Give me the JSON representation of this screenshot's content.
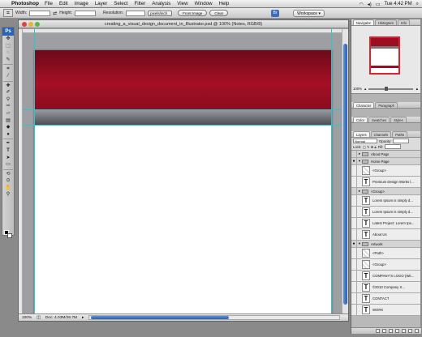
{
  "menubar": {
    "apple": "",
    "app_name": "Photoshop",
    "items": [
      "File",
      "Edit",
      "Image",
      "Layer",
      "Select",
      "Filter",
      "Analysis",
      "View",
      "Window",
      "Help"
    ],
    "clock": "Tue 4:42 PM"
  },
  "options": {
    "width_label": "Width:",
    "height_label": "Height:",
    "resolution_label": "Resolution:",
    "units_value": "pixels/inch",
    "front_image_label": "Front Image",
    "clear_label": "Clear",
    "workspace_label": "Workspace ▾"
  },
  "tools": {
    "logo": "Ps",
    "items": [
      "move",
      "marquee",
      "lasso",
      "quick-select",
      "crop",
      "eyedropper",
      "spot-heal",
      "brush",
      "clone-stamp",
      "history-brush",
      "eraser",
      "gradient",
      "blur",
      "dodge",
      "pen",
      "type",
      "path-select",
      "shape",
      "3d-rotate",
      "3d-orbit",
      "hand",
      "zoom"
    ]
  },
  "document": {
    "title": "creating_a_visual_design_document_in_Illustrator.psd @ 100% (Notes, RGB/8)",
    "zoom": "100%",
    "doc_info": "Doc: 4.03M/26.7M",
    "colors": {
      "banner": "#a50f25",
      "guide": "#28c7d4"
    }
  },
  "navigator": {
    "tabs": [
      "Navigator",
      "Histogram",
      "Info"
    ],
    "zoom": "100%"
  },
  "panel_groups": {
    "group1": [
      "Character",
      "Paragraph"
    ],
    "group2": [
      "Color",
      "Swatches",
      "Styles"
    ]
  },
  "layers": {
    "tabs": [
      "Layers",
      "Channels",
      "Paths"
    ],
    "blend_mode": "Normal",
    "opacity_label": "Opacity:",
    "lock_label": "Lock:",
    "fill_label": "Fill:",
    "items": [
      {
        "name": "About Page",
        "type": "folder",
        "visible": false,
        "expanded": false
      },
      {
        "name": "Home Page",
        "type": "folder",
        "visible": true,
        "expanded": true
      },
      {
        "name": "<Group>",
        "type": "image",
        "visible": false,
        "expanded": false
      },
      {
        "name": "Premium Design Works l...",
        "type": "text",
        "visible": false,
        "expanded": false
      },
      {
        "name": "<Group>",
        "type": "folder",
        "visible": false,
        "expanded": false
      },
      {
        "name": "Lorem Ipsum is simply d...",
        "type": "text",
        "visible": false,
        "expanded": false
      },
      {
        "name": "Lorem Ipsum is simply d...",
        "type": "text",
        "visible": false,
        "expanded": false
      },
      {
        "name": "Latest Project: Lorem Ips...",
        "type": "text",
        "visible": false,
        "expanded": false
      },
      {
        "name": "About Us",
        "type": "text",
        "visible": false,
        "expanded": false
      },
      {
        "name": "Artwork",
        "type": "folder",
        "visible": true,
        "expanded": true
      },
      {
        "name": "<Path>",
        "type": "image",
        "visible": false,
        "expanded": false
      },
      {
        "name": "<Group>",
        "type": "image",
        "visible": false,
        "expanded": false
      },
      {
        "name": "COMPANY'S LOGO (Wit...",
        "type": "text",
        "visible": false,
        "expanded": false
      },
      {
        "name": "©2010 Company X...",
        "type": "text",
        "visible": false,
        "expanded": false
      },
      {
        "name": "CONTACT",
        "type": "text",
        "visible": false,
        "expanded": false
      },
      {
        "name": "WORK",
        "type": "text",
        "visible": false,
        "expanded": false
      }
    ]
  }
}
